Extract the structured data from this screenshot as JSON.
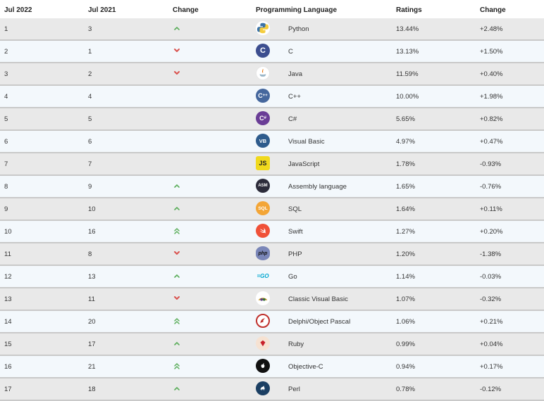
{
  "headers": {
    "jul2022": "Jul 2022",
    "jul2021": "Jul 2021",
    "change": "Change",
    "language": "Programming Language",
    "ratings": "Ratings",
    "delta": "Change"
  },
  "colors": {
    "up": "#5cae5c",
    "down": "#d9534f",
    "row_odd": "#e9e9e9",
    "row_even": "#f3f8fc"
  },
  "rows": [
    {
      "rank": "1",
      "prev": "3",
      "trend": "up",
      "icon": "python-icon",
      "language": "Python",
      "rating": "13.44%",
      "delta": "+2.48%"
    },
    {
      "rank": "2",
      "prev": "1",
      "trend": "down",
      "icon": "c-icon",
      "language": "C",
      "rating": "13.13%",
      "delta": "+1.50%"
    },
    {
      "rank": "3",
      "prev": "2",
      "trend": "down",
      "icon": "java-icon",
      "language": "Java",
      "rating": "11.59%",
      "delta": "+0.40%"
    },
    {
      "rank": "4",
      "prev": "4",
      "trend": "none",
      "icon": "cpp-icon",
      "language": "C++",
      "rating": "10.00%",
      "delta": "+1.98%"
    },
    {
      "rank": "5",
      "prev": "5",
      "trend": "none",
      "icon": "csharp-icon",
      "language": "C#",
      "rating": "5.65%",
      "delta": "+0.82%"
    },
    {
      "rank": "6",
      "prev": "6",
      "trend": "none",
      "icon": "visual-basic-icon",
      "language": "Visual Basic",
      "rating": "4.97%",
      "delta": "+0.47%"
    },
    {
      "rank": "7",
      "prev": "7",
      "trend": "none",
      "icon": "javascript-icon",
      "language": "JavaScript",
      "rating": "1.78%",
      "delta": "-0.93%"
    },
    {
      "rank": "8",
      "prev": "9",
      "trend": "up",
      "icon": "assembly-icon",
      "language": "Assembly language",
      "rating": "1.65%",
      "delta": "-0.76%"
    },
    {
      "rank": "9",
      "prev": "10",
      "trend": "up",
      "icon": "sql-icon",
      "language": "SQL",
      "rating": "1.64%",
      "delta": "+0.11%"
    },
    {
      "rank": "10",
      "prev": "16",
      "trend": "double-up",
      "icon": "swift-icon",
      "language": "Swift",
      "rating": "1.27%",
      "delta": "+0.20%"
    },
    {
      "rank": "11",
      "prev": "8",
      "trend": "down",
      "icon": "php-icon",
      "language": "PHP",
      "rating": "1.20%",
      "delta": "-1.38%"
    },
    {
      "rank": "12",
      "prev": "13",
      "trend": "up",
      "icon": "go-icon",
      "language": "Go",
      "rating": "1.14%",
      "delta": "-0.03%"
    },
    {
      "rank": "13",
      "prev": "11",
      "trend": "down",
      "icon": "classic-vb-icon",
      "language": "Classic Visual Basic",
      "rating": "1.07%",
      "delta": "-0.32%"
    },
    {
      "rank": "14",
      "prev": "20",
      "trend": "double-up",
      "icon": "delphi-icon",
      "language": "Delphi/Object Pascal",
      "rating": "1.06%",
      "delta": "+0.21%"
    },
    {
      "rank": "15",
      "prev": "17",
      "trend": "up",
      "icon": "ruby-icon",
      "language": "Ruby",
      "rating": "0.99%",
      "delta": "+0.04%"
    },
    {
      "rank": "16",
      "prev": "21",
      "trend": "double-up",
      "icon": "objective-c-icon",
      "language": "Objective-C",
      "rating": "0.94%",
      "delta": "+0.17%"
    },
    {
      "rank": "17",
      "prev": "18",
      "trend": "up",
      "icon": "perl-icon",
      "language": "Perl",
      "rating": "0.78%",
      "delta": "-0.12%"
    }
  ]
}
